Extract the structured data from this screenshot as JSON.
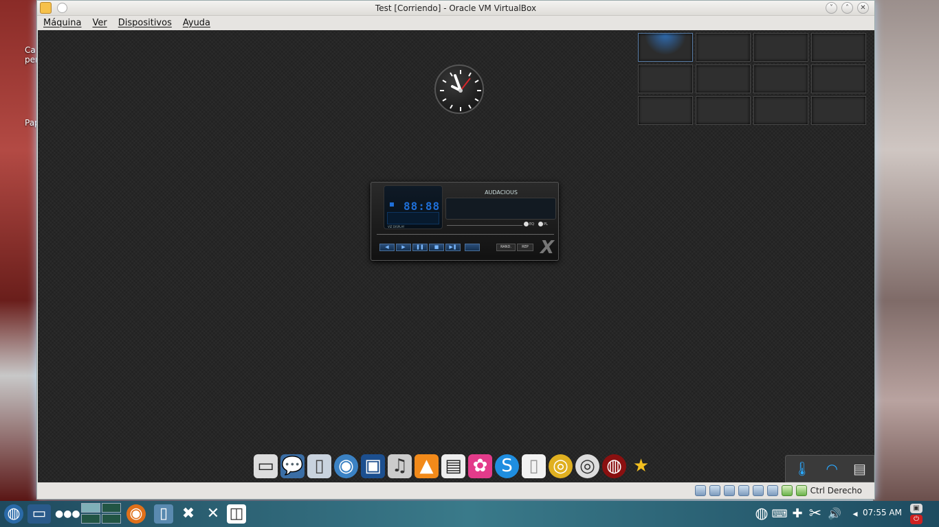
{
  "window": {
    "title": "Test [Corriendo] - Oracle VM VirtualBox"
  },
  "menu": [
    "Máquina",
    "Ver",
    "Dispositivos",
    "Ayuda"
  ],
  "host_desktop_labels": [
    "Ca",
    "per",
    "Pap"
  ],
  "audacious": {
    "title": "AUDACIOUS",
    "time": "88:88",
    "viz_label": "VIZ DISPLAY",
    "eq_label": "EQ",
    "pl_label": "PL",
    "rand_label": "RAND.",
    "rep_label": "REP",
    "logo": "X"
  },
  "statusbar": {
    "host_key": "Ctrl Derecho"
  },
  "taskbar": {
    "clock": "07:55 AM"
  },
  "colors": {
    "accent": "#1f6fd8",
    "guest_bg": "#262626"
  }
}
